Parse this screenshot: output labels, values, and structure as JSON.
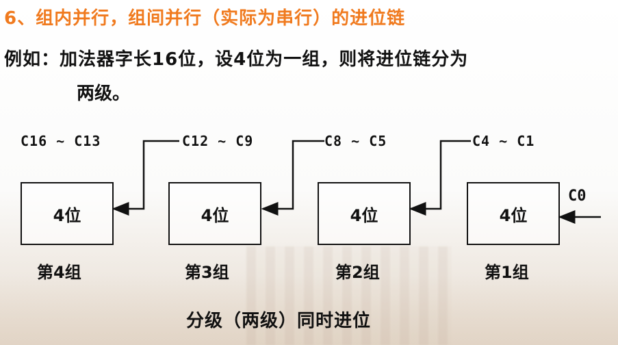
{
  "title": "6、组内并行，组间并行（实际为串行）的进位链",
  "example_line1": "例如：加法器字长16位，设4位为一组，则将进位链分为",
  "example_line2": "两级。",
  "diagram": {
    "carry_labels": [
      "C16 ~ C13",
      "C12 ~ C9",
      "C8 ~ C5",
      "C4 ~ C1"
    ],
    "input_label": "C0",
    "boxes": [
      "4位",
      "4位",
      "4位",
      "4位"
    ],
    "groups": [
      "第4组",
      "第3组",
      "第2组",
      "第1组"
    ],
    "caption": "分级（两级）同时进位"
  }
}
